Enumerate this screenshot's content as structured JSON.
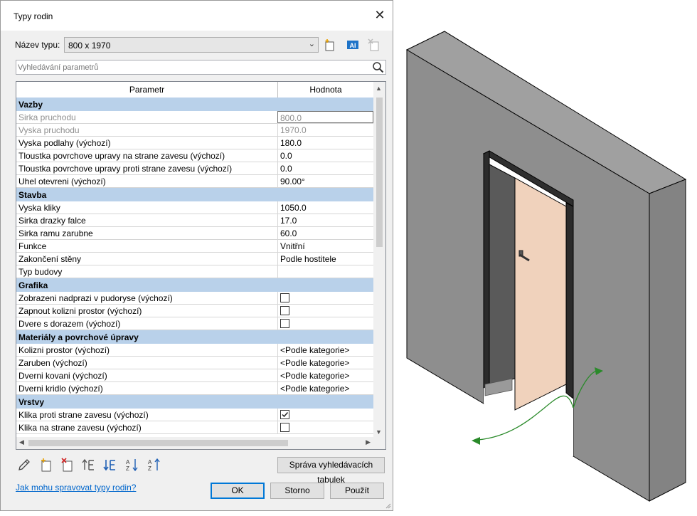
{
  "dialog": {
    "title": "Typy rodin",
    "type_name_label": "Název typu:",
    "type_name_value": "800 x 1970",
    "search_placeholder": "Vyhledávání parametrů",
    "grid": {
      "col_param": "Parametr",
      "col_value": "Hodnota",
      "sections": [
        {
          "name": "Vazby",
          "rows": [
            {
              "name": "Sirka pruchodu",
              "value": "800.0",
              "disabled": true,
              "selected": true
            },
            {
              "name": "Vyska pruchodu",
              "value": "1970.0",
              "disabled": true
            },
            {
              "name": "Vyska podlahy (výchozí)",
              "value": "180.0"
            },
            {
              "name": "Tloustka povrchove upravy na strane zavesu (výchozí)",
              "value": "0.0"
            },
            {
              "name": "Tloustka povrchove upravy proti strane zavesu (výchozí)",
              "value": "0.0"
            },
            {
              "name": "Uhel otevreni (výchozí)",
              "value": "90.00°"
            }
          ]
        },
        {
          "name": "Stavba",
          "rows": [
            {
              "name": "Vyska kliky",
              "value": "1050.0"
            },
            {
              "name": "Sirka drazky falce",
              "value": "17.0"
            },
            {
              "name": "Sirka ramu zarubne",
              "value": "60.0"
            },
            {
              "name": "Funkce",
              "value": "Vnitřní"
            },
            {
              "name": "Zakončení stěny",
              "value": "Podle hostitele"
            },
            {
              "name": "Typ budovy",
              "value": ""
            }
          ]
        },
        {
          "name": "Grafika",
          "rows": [
            {
              "name": "Zobrazeni nadprazi v pudoryse (výchozí)",
              "checkbox": true,
              "checked": false
            },
            {
              "name": "Zapnout kolizni prostor (výchozí)",
              "checkbox": true,
              "checked": false
            },
            {
              "name": "Dvere s dorazem (výchozí)",
              "checkbox": true,
              "checked": false
            }
          ]
        },
        {
          "name": "Materiály a povrchové úpravy",
          "rows": [
            {
              "name": "Kolizni prostor (výchozí)",
              "value": "<Podle kategorie>"
            },
            {
              "name": "Zaruben (výchozí)",
              "value": "<Podle kategorie>"
            },
            {
              "name": "Dverni kovani (výchozí)",
              "value": "<Podle kategorie>"
            },
            {
              "name": "Dverni kridlo (výchozí)",
              "value": "<Podle kategorie>"
            }
          ]
        },
        {
          "name": "Vrstvy",
          "rows": [
            {
              "name": "Klika proti strane zavesu (výchozí)",
              "checkbox": true,
              "checked": true
            },
            {
              "name": "Klika na strane zavesu (výchozí)",
              "checkbox": true,
              "checked": false
            }
          ]
        }
      ]
    },
    "lookup_button": "Správa vyhledávacích tabulek",
    "help_link": "Jak mohu spravovat typy rodin?",
    "ok": "OK",
    "cancel": "Storno",
    "apply": "Použít"
  },
  "icons": [
    "close-icon",
    "new-type-icon",
    "rename-type-icon",
    "delete-type-icon",
    "search-icon",
    "edit-pencil-icon",
    "new-parameter-icon",
    "delete-parameter-icon",
    "move-up-icon",
    "move-down-icon",
    "sort-ascending-icon",
    "sort-descending-icon"
  ],
  "colors": {
    "category_header": "#b9d1ea",
    "wall_face": "#8c8c8c",
    "wall_top": "#9c9c9c",
    "door_leaf": "#f0d2bc",
    "arrow": "#2a8a2a"
  }
}
